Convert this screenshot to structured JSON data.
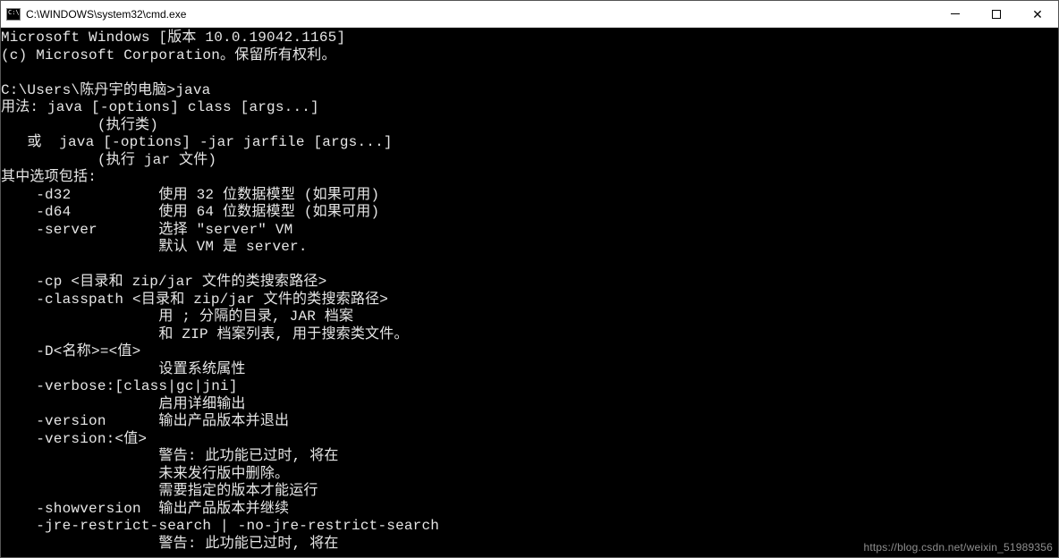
{
  "window": {
    "title": "C:\\WINDOWS\\system32\\cmd.exe"
  },
  "terminal": {
    "lines": [
      "Microsoft Windows [版本 10.0.19042.1165]",
      "(c) Microsoft Corporation。保留所有权利。",
      "",
      "C:\\Users\\陈丹宇的电脑>java",
      "用法: java [-options] class [args...]",
      "           (执行类)",
      "   或  java [-options] -jar jarfile [args...]",
      "           (执行 jar 文件)",
      "其中选项包括:",
      "    -d32          使用 32 位数据模型 (如果可用)",
      "    -d64          使用 64 位数据模型 (如果可用)",
      "    -server       选择 \"server\" VM",
      "                  默认 VM 是 server.",
      "",
      "    -cp <目录和 zip/jar 文件的类搜索路径>",
      "    -classpath <目录和 zip/jar 文件的类搜索路径>",
      "                  用 ; 分隔的目录, JAR 档案",
      "                  和 ZIP 档案列表, 用于搜索类文件。",
      "    -D<名称>=<值>",
      "                  设置系统属性",
      "    -verbose:[class|gc|jni]",
      "                  启用详细输出",
      "    -version      输出产品版本并退出",
      "    -version:<值>",
      "                  警告: 此功能已过时, 将在",
      "                  未来发行版中删除。",
      "                  需要指定的版本才能运行",
      "    -showversion  输出产品版本并继续",
      "    -jre-restrict-search | -no-jre-restrict-search",
      "                  警告: 此功能已过时, 将在"
    ]
  },
  "watermark": "https://blog.csdn.net/weixin_51989356"
}
